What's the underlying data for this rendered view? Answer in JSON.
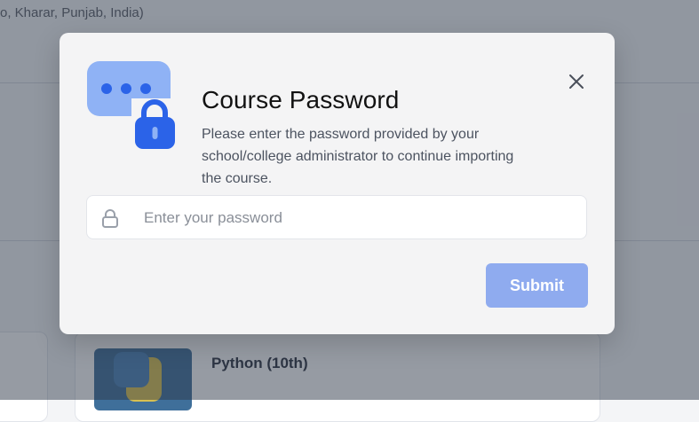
{
  "background": {
    "location_text": "o, Kharar, Punjab, India)",
    "course_card_title": "Python (10th)"
  },
  "modal": {
    "title": "Course Password",
    "description": "Please enter the password provided by your school/college administrator to continue importing the course.",
    "close_icon": "close-icon",
    "password_field": {
      "icon": "lock-icon",
      "placeholder": "Enter your password",
      "value": ""
    },
    "submit_label": "Submit"
  },
  "colors": {
    "accent": "#2b63e8",
    "accent_light": "#8fb2f5",
    "submit_button": "#8fabef",
    "overlay": "#2d3748"
  }
}
